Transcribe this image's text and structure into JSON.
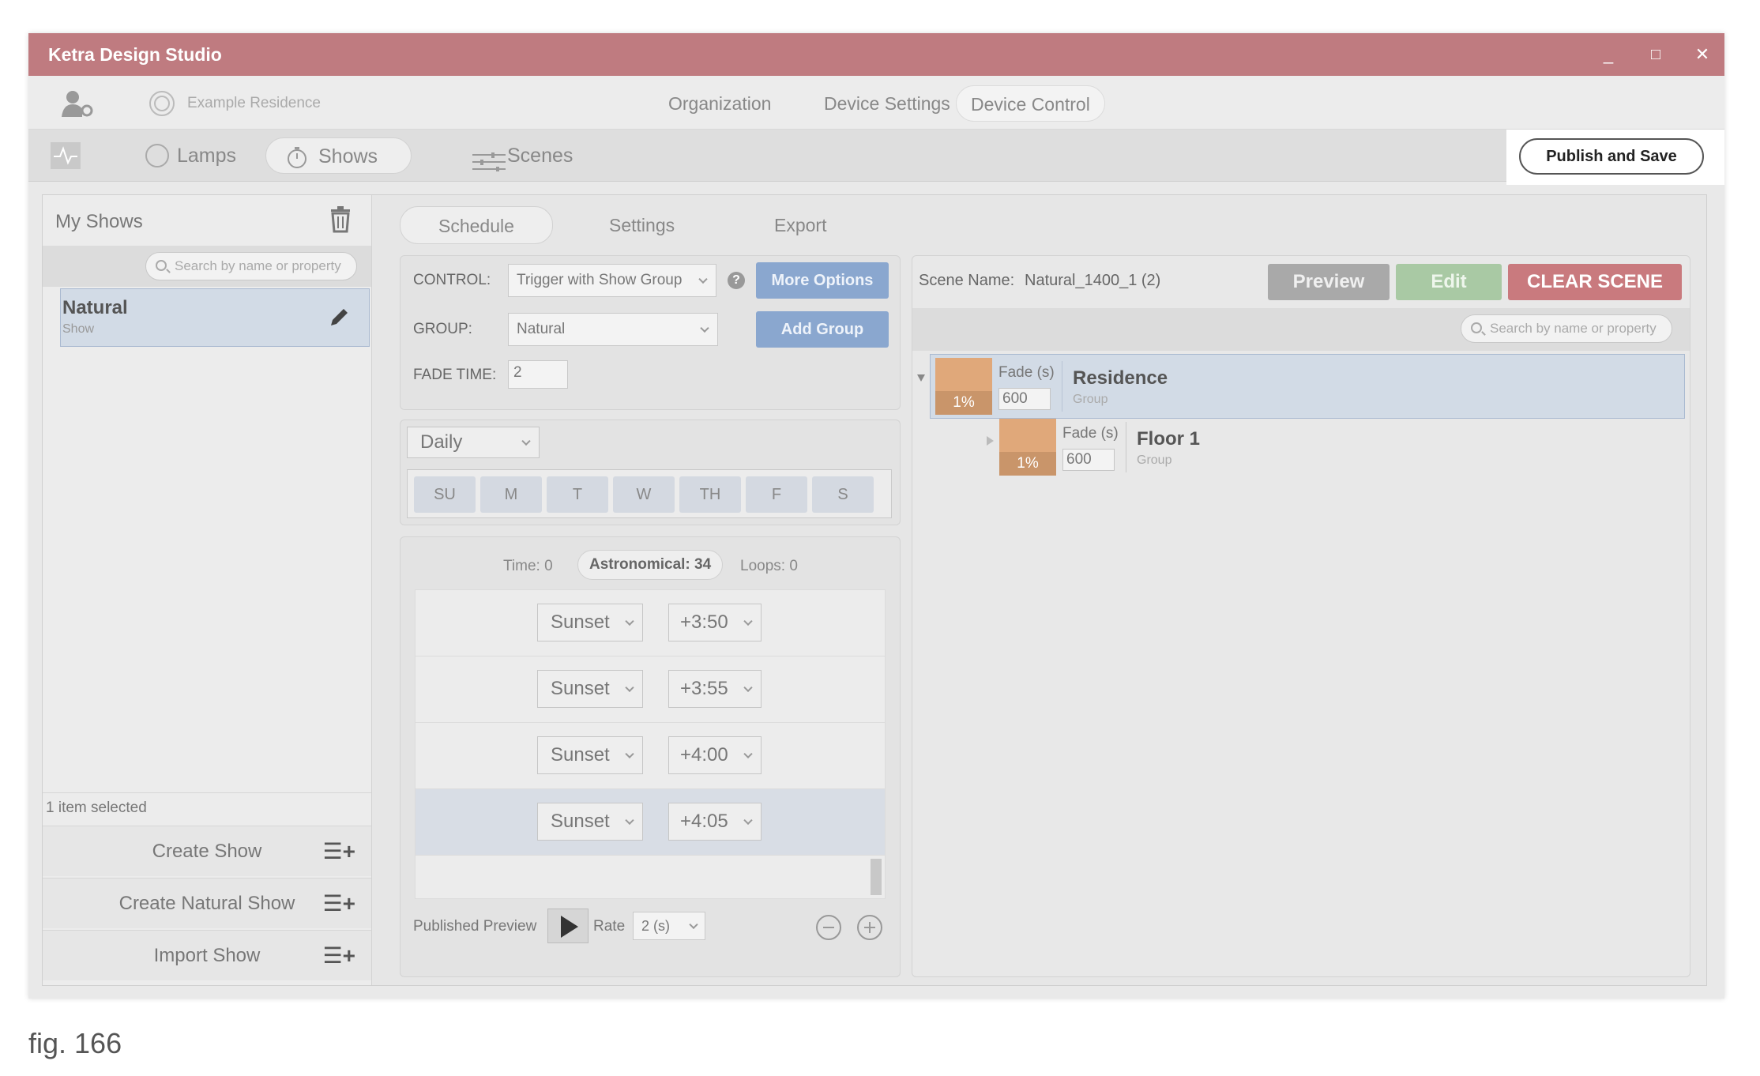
{
  "window": {
    "title": "Ketra Design Studio",
    "controls": {
      "minimize": "_",
      "maximize": "□",
      "close": "✕"
    }
  },
  "topnav": {
    "project": "Example Residence",
    "tabs": [
      "Organization",
      "Device Settings",
      "Device Control"
    ],
    "active_tab": "Device Control"
  },
  "subnav": {
    "tabs": [
      "Lamps",
      "Shows",
      "Scenes"
    ],
    "active_tab": "Shows",
    "publish_label": "Publish and Save"
  },
  "left": {
    "title": "My Shows",
    "search_placeholder": "Search by name or property",
    "items": [
      {
        "name": "Natural",
        "type": "Show"
      }
    ],
    "status": "1 item selected",
    "actions": [
      "Create Show",
      "Create Natural Show",
      "Import Show"
    ]
  },
  "middle": {
    "tabs": [
      "Schedule",
      "Settings",
      "Export"
    ],
    "active_tab": "Schedule",
    "control_label": "CONTROL:",
    "control_value": "Trigger with Show Group",
    "more_options": "More Options",
    "group_label": "GROUP:",
    "group_value": "Natural",
    "add_group": "Add Group",
    "fade_label": "FADE TIME:",
    "fade_value": "2",
    "repeat": "Daily",
    "days": [
      "SU",
      "M",
      "T",
      "W",
      "TH",
      "F",
      "S"
    ],
    "counts": {
      "time": "Time: 0",
      "astro": "Astronomical: 34",
      "loops": "Loops: 0"
    },
    "rows": [
      {
        "event": "Sunset",
        "offset": "+3:50"
      },
      {
        "event": "Sunset",
        "offset": "+3:55"
      },
      {
        "event": "Sunset",
        "offset": "+4:00"
      },
      {
        "event": "Sunset",
        "offset": "+4:05"
      }
    ],
    "published_preview": "Published Preview",
    "rate_label": "Rate",
    "rate_value": "2 (s)"
  },
  "right": {
    "scene_label": "Scene Name:",
    "scene_name": "Natural_1400_1 (2)",
    "preview": "Preview",
    "edit": "Edit",
    "clear": "CLEAR SCENE",
    "search_placeholder": "Search by name or property",
    "groups": [
      {
        "name": "Residence",
        "type": "Group",
        "level": "1%",
        "fade_label": "Fade (s)",
        "fade": "600"
      },
      {
        "name": "Floor 1",
        "type": "Group",
        "level": "1%",
        "fade_label": "Fade (s)",
        "fade": "600"
      }
    ]
  },
  "caption": "fig. 166",
  "colors": {
    "titlebar": "#bf7b80",
    "accent_blue": "#8aa7cf",
    "clear_red": "#c97a7e",
    "edit_green": "#a9c9a4",
    "swatch": "#e0a87a"
  }
}
